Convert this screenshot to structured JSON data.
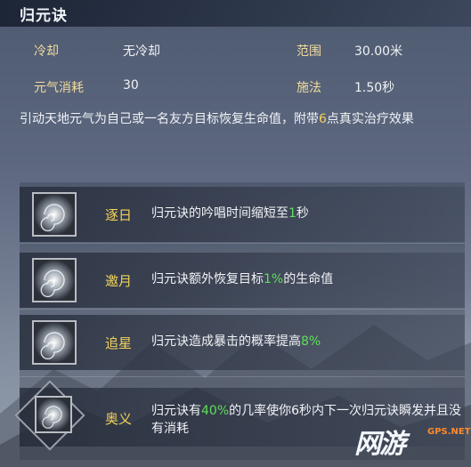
{
  "skill": {
    "title": "归元诀",
    "cooldown_label": "冷却",
    "cooldown_value": "无冷却",
    "range_label": "范围",
    "range_value": "30.00米",
    "cost_label": "元气消耗",
    "cost_value": "30",
    "cast_label": "施法",
    "cast_value": "1.50秒",
    "description": {
      "pre": "引动天地元气为自己或一名友方目标恢复生命值，附带",
      "number": "6",
      "post": "点真实治疗效果"
    }
  },
  "talents": [
    {
      "name": "逐日",
      "pre": "归元诀的吟唱时间缩短至",
      "value": "1",
      "post": "秒",
      "icon": "swirl-icon"
    },
    {
      "name": "邀月",
      "pre": "归元诀额外恢复目标",
      "value": "1%",
      "post": "的生命值",
      "icon": "swirl-icon"
    },
    {
      "name": "追星",
      "pre": "归元诀造成暴击的概率提高",
      "value": "8%",
      "post": "",
      "icon": "swirl-icon"
    },
    {
      "name": "奥义",
      "pre": "归元诀有",
      "value": "40%",
      "post": "的几率使你6秒内下一次归元诀瞬发并且没有消耗",
      "icon": "swirl-icon"
    }
  ],
  "watermark": {
    "main": "网游",
    "sub": "GPS.NET"
  },
  "colors": {
    "label": "#f2dc9e",
    "highlight": "#f3d25a",
    "green": "#5ee05a"
  }
}
